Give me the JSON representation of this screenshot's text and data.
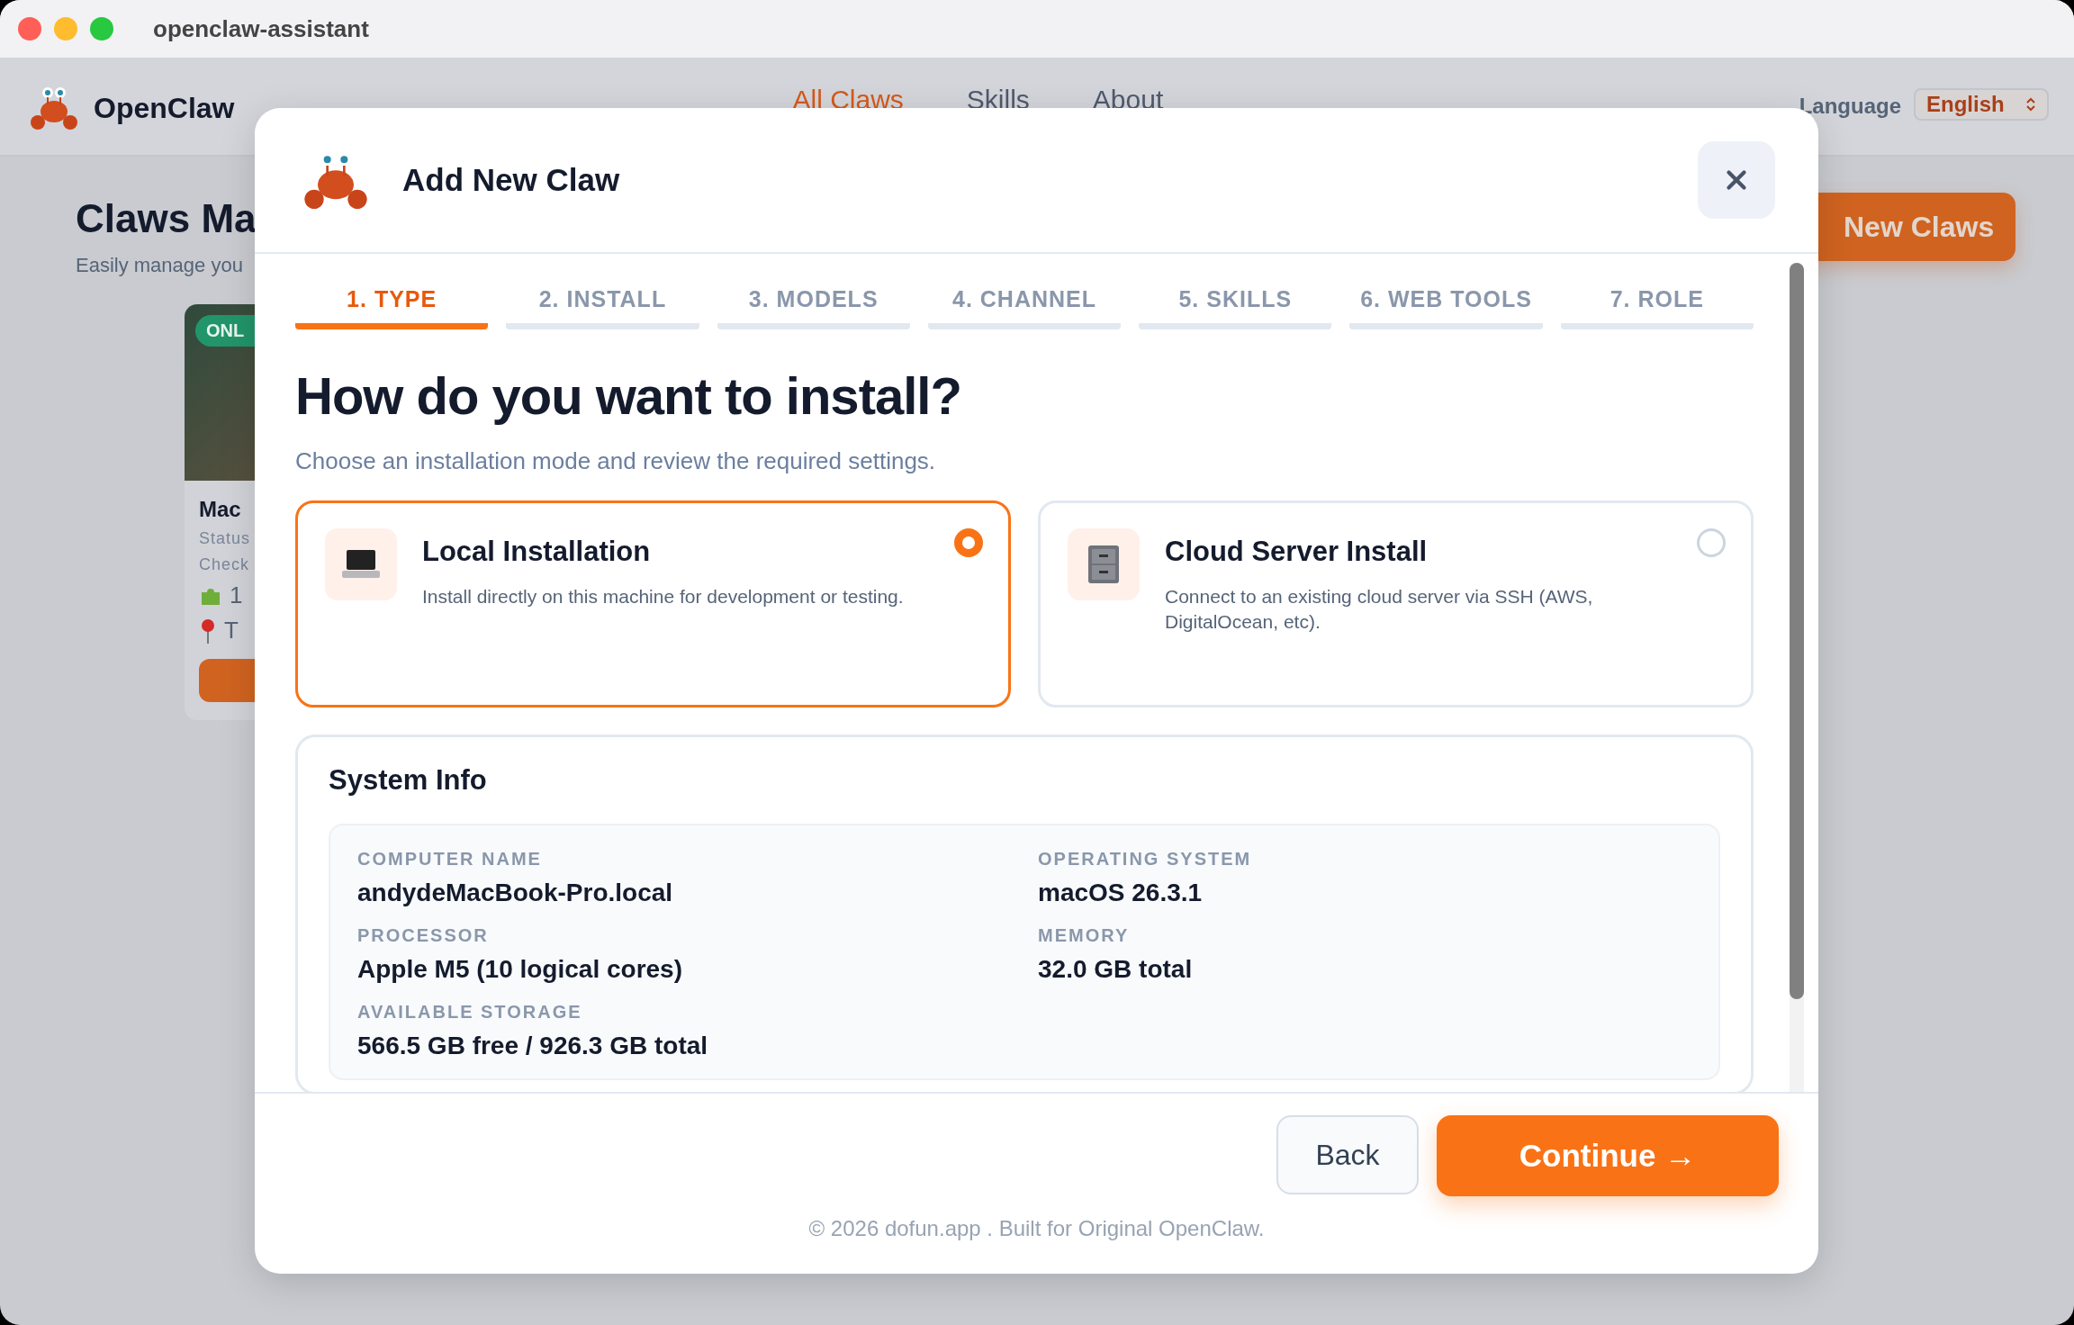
{
  "window": {
    "title": "openclaw-assistant"
  },
  "header": {
    "brand": "OpenClaw",
    "nav": [
      {
        "label": "All Claws",
        "selected": true
      },
      {
        "label": "Skills",
        "selected": false
      },
      {
        "label": "About",
        "selected": false
      }
    ],
    "language_label": "Language",
    "language_value": "English"
  },
  "page": {
    "title": "Claws Ma",
    "subtitle": "Easily manage you",
    "new_button": "New Claws",
    "card": {
      "badge": "ONL",
      "name": "Mac",
      "status": "Status",
      "checked": "Check",
      "skills": "1",
      "location": "T"
    }
  },
  "dialog": {
    "title": "Add New Claw",
    "steps": [
      {
        "label": "1. TYPE",
        "selected": true
      },
      {
        "label": "2. INSTALL",
        "selected": false
      },
      {
        "label": "3. MODELS",
        "selected": false
      },
      {
        "label": "4. CHANNEL",
        "selected": false
      },
      {
        "label": "5. SKILLS",
        "selected": false
      },
      {
        "label": "6. WEB TOOLS",
        "selected": false
      },
      {
        "label": "7. ROLE",
        "selected": false
      }
    ],
    "heading": "How do you want to install?",
    "subheading": "Choose an installation mode and review the required settings.",
    "options": [
      {
        "kind": "laptop",
        "title": "Local Installation",
        "description": "Install directly on this machine for development or testing.",
        "selected": true
      },
      {
        "kind": "cabinet",
        "title": "Cloud Server Install",
        "description": "Connect to an existing cloud server via SSH (AWS, DigitalOcean, etc).",
        "selected": false
      }
    ],
    "system_info": {
      "title": "System Info",
      "fields": [
        {
          "label": "COMPUTER NAME",
          "value": "andydeMacBook-Pro.local"
        },
        {
          "label": "OPERATING SYSTEM",
          "value": "macOS 26.3.1"
        },
        {
          "label": "PROCESSOR",
          "value": "Apple M5 (10 logical cores)"
        },
        {
          "label": "MEMORY",
          "value": "32.0 GB total"
        },
        {
          "label": "AVAILABLE STORAGE",
          "value": "566.5 GB free / 926.3 GB total"
        }
      ]
    },
    "back_button": "Back",
    "continue_button": "Continue →",
    "footer": "© 2026 dofun.app . Built for Original OpenClaw."
  }
}
